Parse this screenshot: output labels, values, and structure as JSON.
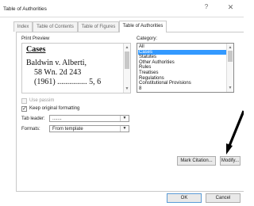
{
  "dialog": {
    "title": "Table of Authorities",
    "help_glyph": "?",
    "close_glyph": "✕"
  },
  "tabs": [
    {
      "label": "Index",
      "active": false
    },
    {
      "label": "Table of Contents",
      "active": false
    },
    {
      "label": "Table of Figures",
      "active": false
    },
    {
      "label": "Table of Authorities",
      "active": true
    }
  ],
  "print_preview": {
    "label": "Print Preview",
    "heading": "Cases",
    "entry_lines": [
      "Baldwin v. Alberti,",
      "    58 Wn. 2d 243",
      "    (1961) ............... 5, 6"
    ]
  },
  "category": {
    "label": "Category:",
    "items": [
      "All",
      "Cases",
      "Statutes",
      "Other Authorities",
      "Rules",
      "Treatises",
      "Regulations",
      "Constitutional Provisions",
      "8"
    ],
    "selected": "Cases"
  },
  "options": {
    "use_passim": {
      "label": "Use passim",
      "checked": false,
      "enabled": false
    },
    "keep_original_formatting": {
      "label": "Keep original formatting",
      "checked": true,
      "enabled": true
    }
  },
  "tab_leader": {
    "label": "Tab leader:",
    "value": "......."
  },
  "formats": {
    "label": "Formats:",
    "value": "From template"
  },
  "buttons": {
    "mark_citation": "Mark Citation...",
    "modify": "Modify...",
    "ok": "OK",
    "cancel": "Cancel"
  },
  "colors": {
    "selection": "#3399ff",
    "arrow": "#000000",
    "default_button_border": "#5b9bd5"
  }
}
